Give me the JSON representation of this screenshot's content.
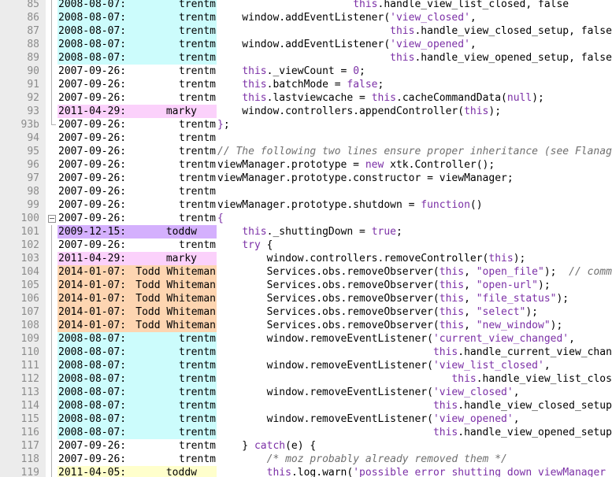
{
  "colors": {
    "trentm_2008": "#ccfcfc",
    "trentm_2007": "#ffffff",
    "marky": "#fbd1fb",
    "toddw_2009": "#d4b0fd",
    "todd_whiteman": "#fdd5b1",
    "toddw_2011": "#ffffcc"
  },
  "lines": [
    {
      "num": "85",
      "date": "2008-08-07:",
      "author": "trentm",
      "color": "#ccfcfc",
      "fold": "line",
      "code": [
        [
          "                      ",
          "pl"
        ],
        [
          "this",
          "th"
        ],
        [
          ".handle_view_list_closed, false",
          "pl"
        ]
      ]
    },
    {
      "num": "86",
      "date": "2008-08-07:",
      "author": "trentm",
      "color": "#ccfcfc",
      "fold": "line",
      "code": [
        [
          "    window.addEventListener(",
          "pl"
        ],
        [
          "'view_closed'",
          "st"
        ],
        [
          ",",
          "pl"
        ]
      ]
    },
    {
      "num": "87",
      "date": "2008-08-07:",
      "author": "trentm",
      "color": "#ccfcfc",
      "fold": "line",
      "code": [
        [
          "                            ",
          "pl"
        ],
        [
          "this",
          "th"
        ],
        [
          ".handle_view_closed_setup, false",
          "pl"
        ]
      ]
    },
    {
      "num": "88",
      "date": "2008-08-07:",
      "author": "trentm",
      "color": "#ccfcfc",
      "fold": "line",
      "code": [
        [
          "    window.addEventListener(",
          "pl"
        ],
        [
          "'view_opened'",
          "st"
        ],
        [
          ",",
          "pl"
        ]
      ]
    },
    {
      "num": "89",
      "date": "2008-08-07:",
      "author": "trentm",
      "color": "#ccfcfc",
      "fold": "line",
      "code": [
        [
          "                            ",
          "pl"
        ],
        [
          "this",
          "th"
        ],
        [
          ".handle_view_opened_setup, false",
          "pl"
        ]
      ]
    },
    {
      "num": "90",
      "date": "2007-09-26:",
      "author": "trentm",
      "color": "#ffffff",
      "fold": "line",
      "code": [
        [
          "    ",
          "pl"
        ],
        [
          "this",
          "th"
        ],
        [
          "._viewCount = ",
          "pl"
        ],
        [
          "0",
          "st"
        ],
        [
          ";",
          "pl"
        ]
      ]
    },
    {
      "num": "91",
      "date": "2007-09-26:",
      "author": "trentm",
      "color": "#ffffff",
      "fold": "line",
      "code": [
        [
          "    ",
          "pl"
        ],
        [
          "this",
          "th"
        ],
        [
          ".batchMode = ",
          "pl"
        ],
        [
          "false",
          "kw"
        ],
        [
          ";",
          "pl"
        ]
      ]
    },
    {
      "num": "92",
      "date": "2007-09-26:",
      "author": "trentm",
      "color": "#ffffff",
      "fold": "line",
      "code": [
        [
          "    ",
          "pl"
        ],
        [
          "this",
          "th"
        ],
        [
          ".lastviewcache = ",
          "pl"
        ],
        [
          "this",
          "th"
        ],
        [
          ".cacheCommandData(",
          "pl"
        ],
        [
          "null",
          "kw"
        ],
        [
          ");",
          "pl"
        ]
      ]
    },
    {
      "num": "93",
      "date": "2011-04-29:",
      "author": "marky",
      "color": "#fbd1fb",
      "fold": "line",
      "mid": true,
      "code": [
        [
          "    window.controllers.appendController(",
          "pl"
        ],
        [
          "this",
          "th"
        ],
        [
          ");",
          "pl"
        ]
      ]
    },
    {
      "num": "93b",
      "date": "2007-09-26:",
      "author": "trentm",
      "color": "#ffffff",
      "fold": "end",
      "code": [
        [
          "}",
          "kw"
        ],
        [
          ";",
          "pl"
        ]
      ]
    },
    {
      "num": "94",
      "date": "2007-09-26:",
      "author": "trentm",
      "color": "#ffffff",
      "fold": "",
      "code": [
        [
          "",
          "pl"
        ]
      ]
    },
    {
      "num": "95",
      "date": "2007-09-26:",
      "author": "trentm",
      "color": "#ffffff",
      "fold": "",
      "code": [
        [
          "// The following two lines ensure proper inheritance (see Flanagan",
          "cm"
        ]
      ]
    },
    {
      "num": "96",
      "date": "2007-09-26:",
      "author": "trentm",
      "color": "#ffffff",
      "fold": "",
      "code": [
        [
          "viewManager.prototype = ",
          "pl"
        ],
        [
          "new",
          "kw"
        ],
        [
          " xtk.Controller();",
          "pl"
        ]
      ]
    },
    {
      "num": "97",
      "date": "2007-09-26:",
      "author": "trentm",
      "color": "#ffffff",
      "fold": "",
      "code": [
        [
          "viewManager.prototype.constructor = viewManager;",
          "pl"
        ]
      ]
    },
    {
      "num": "98",
      "date": "2007-09-26:",
      "author": "trentm",
      "color": "#ffffff",
      "fold": "",
      "code": [
        [
          "",
          "pl"
        ]
      ]
    },
    {
      "num": "99",
      "date": "2007-09-26:",
      "author": "trentm",
      "color": "#ffffff",
      "fold": "",
      "code": [
        [
          "viewManager.prototype.shutdown = ",
          "pl"
        ],
        [
          "function",
          "kw"
        ],
        [
          "()",
          "pl"
        ]
      ]
    },
    {
      "num": "100",
      "date": "2007-09-26:",
      "author": "trentm",
      "color": "#ffffff",
      "fold": "box",
      "code": [
        [
          "{",
          "kw"
        ]
      ]
    },
    {
      "num": "101",
      "date": "2009-12-15:",
      "author": "toddw",
      "color": "#d4b0fd",
      "fold": "line",
      "mid": true,
      "code": [
        [
          "    ",
          "pl"
        ],
        [
          "this",
          "th"
        ],
        [
          "._shuttingDown = ",
          "pl"
        ],
        [
          "true",
          "kw"
        ],
        [
          ";",
          "pl"
        ]
      ]
    },
    {
      "num": "102",
      "date": "2007-09-26:",
      "author": "trentm",
      "color": "#ffffff",
      "fold": "line",
      "code": [
        [
          "    ",
          "pl"
        ],
        [
          "try",
          "kw"
        ],
        [
          " {",
          "pl"
        ]
      ]
    },
    {
      "num": "103",
      "date": "2011-04-29:",
      "author": "marky",
      "color": "#fbd1fb",
      "fold": "line",
      "mid": true,
      "code": [
        [
          "        window.controllers.removeController(",
          "pl"
        ],
        [
          "this",
          "th"
        ],
        [
          ");",
          "pl"
        ]
      ]
    },
    {
      "num": "104",
      "date": "2014-01-07:",
      "author": "Todd Whiteman",
      "color": "#fdd5b1",
      "fold": "line",
      "code": [
        [
          "        Services.obs.removeObserver(",
          "pl"
        ],
        [
          "this",
          "th"
        ],
        [
          ", ",
          "pl"
        ],
        [
          "\"open_file\"",
          "st"
        ],
        [
          ");  ",
          "pl"
        ],
        [
          "// comment",
          "cm"
        ]
      ]
    },
    {
      "num": "105",
      "date": "2014-01-07:",
      "author": "Todd Whiteman",
      "color": "#fdd5b1",
      "fold": "line",
      "code": [
        [
          "        Services.obs.removeObserver(",
          "pl"
        ],
        [
          "this",
          "th"
        ],
        [
          ", ",
          "pl"
        ],
        [
          "\"open-url\"",
          "st"
        ],
        [
          ");",
          "pl"
        ]
      ]
    },
    {
      "num": "106",
      "date": "2014-01-07:",
      "author": "Todd Whiteman",
      "color": "#fdd5b1",
      "fold": "line",
      "code": [
        [
          "        Services.obs.removeObserver(",
          "pl"
        ],
        [
          "this",
          "th"
        ],
        [
          ", ",
          "pl"
        ],
        [
          "\"file_status\"",
          "st"
        ],
        [
          ");",
          "pl"
        ]
      ]
    },
    {
      "num": "107",
      "date": "2014-01-07:",
      "author": "Todd Whiteman",
      "color": "#fdd5b1",
      "fold": "line",
      "code": [
        [
          "        Services.obs.removeObserver(",
          "pl"
        ],
        [
          "this",
          "th"
        ],
        [
          ", ",
          "pl"
        ],
        [
          "\"select\"",
          "st"
        ],
        [
          ");",
          "pl"
        ]
      ]
    },
    {
      "num": "108",
      "date": "2014-01-07:",
      "author": "Todd Whiteman",
      "color": "#fdd5b1",
      "fold": "line",
      "code": [
        [
          "        Services.obs.removeObserver(",
          "pl"
        ],
        [
          "this",
          "th"
        ],
        [
          ", ",
          "pl"
        ],
        [
          "\"new_window\"",
          "st"
        ],
        [
          ");",
          "pl"
        ]
      ]
    },
    {
      "num": "109",
      "date": "2008-08-07:",
      "author": "trentm",
      "color": "#ccfcfc",
      "fold": "line",
      "code": [
        [
          "        window.removeEventListener(",
          "pl"
        ],
        [
          "'current_view_changed'",
          "st"
        ],
        [
          ",",
          "pl"
        ]
      ]
    },
    {
      "num": "110",
      "date": "2008-08-07:",
      "author": "trentm",
      "color": "#ccfcfc",
      "fold": "line",
      "code": [
        [
          "                                   ",
          "pl"
        ],
        [
          "this",
          "th"
        ],
        [
          ".handle_current_view_changed",
          "pl"
        ]
      ]
    },
    {
      "num": "111",
      "date": "2008-08-07:",
      "author": "trentm",
      "color": "#ccfcfc",
      "fold": "line",
      "code": [
        [
          "        window.removeEventListener(",
          "pl"
        ],
        [
          "'view_list_closed'",
          "st"
        ],
        [
          ",",
          "pl"
        ]
      ]
    },
    {
      "num": "112",
      "date": "2008-08-07:",
      "author": "trentm",
      "color": "#ccfcfc",
      "fold": "line",
      "code": [
        [
          "                                      ",
          "pl"
        ],
        [
          "this",
          "th"
        ],
        [
          ".handle_view_list_closed",
          "pl"
        ]
      ]
    },
    {
      "num": "113",
      "date": "2008-08-07:",
      "author": "trentm",
      "color": "#ccfcfc",
      "fold": "line",
      "code": [
        [
          "        window.removeEventListener(",
          "pl"
        ],
        [
          "'view_closed'",
          "st"
        ],
        [
          ",",
          "pl"
        ]
      ]
    },
    {
      "num": "114",
      "date": "2008-08-07:",
      "author": "trentm",
      "color": "#ccfcfc",
      "fold": "line",
      "code": [
        [
          "                                   ",
          "pl"
        ],
        [
          "this",
          "th"
        ],
        [
          ".handle_view_closed_setup, f",
          "pl"
        ]
      ]
    },
    {
      "num": "115",
      "date": "2008-08-07:",
      "author": "trentm",
      "color": "#ccfcfc",
      "fold": "line",
      "code": [
        [
          "        window.removeEventListener(",
          "pl"
        ],
        [
          "'view_opened'",
          "st"
        ],
        [
          ",",
          "pl"
        ]
      ]
    },
    {
      "num": "116",
      "date": "2008-08-07:",
      "author": "trentm",
      "color": "#ccfcfc",
      "fold": "line",
      "code": [
        [
          "                                   ",
          "pl"
        ],
        [
          "this",
          "th"
        ],
        [
          ".handle_view_opened_setup, f",
          "pl"
        ]
      ]
    },
    {
      "num": "117",
      "date": "2007-09-26:",
      "author": "trentm",
      "color": "#ffffff",
      "fold": "line",
      "code": [
        [
          "    } ",
          "pl"
        ],
        [
          "catch",
          "kw"
        ],
        [
          "(e) {",
          "pl"
        ]
      ]
    },
    {
      "num": "118",
      "date": "2007-09-26:",
      "author": "trentm",
      "color": "#ffffff",
      "fold": "line",
      "code": [
        [
          "        ",
          "pl"
        ],
        [
          "/* moz probably already removed them */",
          "cm"
        ]
      ]
    },
    {
      "num": "119",
      "date": "2011-04-05:",
      "author": "toddw",
      "color": "#ffffcc",
      "fold": "line",
      "mid": true,
      "code": [
        [
          "        ",
          "pl"
        ],
        [
          "this",
          "th"
        ],
        [
          ".log.warn(",
          "pl"
        ],
        [
          "'possible error shutting down viewManager",
          "st"
        ]
      ]
    }
  ]
}
